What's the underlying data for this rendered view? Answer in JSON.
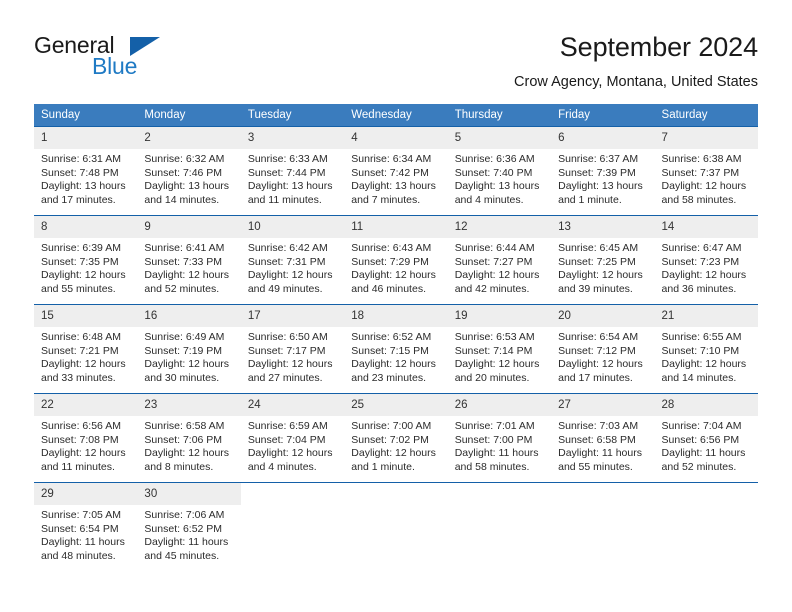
{
  "brand": {
    "name_part1": "General",
    "name_part2": "Blue",
    "logo_icon": "triangle-logo-icon"
  },
  "header": {
    "title": "September 2024",
    "subtitle": "Crow Agency, Montana, United States"
  },
  "colors": {
    "header_blue": "#3a7cbe",
    "row_border_blue": "#1460a8",
    "daynum_band": "#eeeeee",
    "brand_blue": "#1f7ac4",
    "text": "#2b2b2b"
  },
  "weekday_headers": [
    "Sunday",
    "Monday",
    "Tuesday",
    "Wednesday",
    "Thursday",
    "Friday",
    "Saturday"
  ],
  "labels": {
    "sunrise": "Sunrise:",
    "sunset": "Sunset:",
    "daylight": "Daylight:"
  },
  "weeks": [
    [
      {
        "day": "1",
        "sunrise": "Sunrise: 6:31 AM",
        "sunset": "Sunset: 7:48 PM",
        "daylight": "Daylight: 13 hours and 17 minutes."
      },
      {
        "day": "2",
        "sunrise": "Sunrise: 6:32 AM",
        "sunset": "Sunset: 7:46 PM",
        "daylight": "Daylight: 13 hours and 14 minutes."
      },
      {
        "day": "3",
        "sunrise": "Sunrise: 6:33 AM",
        "sunset": "Sunset: 7:44 PM",
        "daylight": "Daylight: 13 hours and 11 minutes."
      },
      {
        "day": "4",
        "sunrise": "Sunrise: 6:34 AM",
        "sunset": "Sunset: 7:42 PM",
        "daylight": "Daylight: 13 hours and 7 minutes."
      },
      {
        "day": "5",
        "sunrise": "Sunrise: 6:36 AM",
        "sunset": "Sunset: 7:40 PM",
        "daylight": "Daylight: 13 hours and 4 minutes."
      },
      {
        "day": "6",
        "sunrise": "Sunrise: 6:37 AM",
        "sunset": "Sunset: 7:39 PM",
        "daylight": "Daylight: 13 hours and 1 minute."
      },
      {
        "day": "7",
        "sunrise": "Sunrise: 6:38 AM",
        "sunset": "Sunset: 7:37 PM",
        "daylight": "Daylight: 12 hours and 58 minutes."
      }
    ],
    [
      {
        "day": "8",
        "sunrise": "Sunrise: 6:39 AM",
        "sunset": "Sunset: 7:35 PM",
        "daylight": "Daylight: 12 hours and 55 minutes."
      },
      {
        "day": "9",
        "sunrise": "Sunrise: 6:41 AM",
        "sunset": "Sunset: 7:33 PM",
        "daylight": "Daylight: 12 hours and 52 minutes."
      },
      {
        "day": "10",
        "sunrise": "Sunrise: 6:42 AM",
        "sunset": "Sunset: 7:31 PM",
        "daylight": "Daylight: 12 hours and 49 minutes."
      },
      {
        "day": "11",
        "sunrise": "Sunrise: 6:43 AM",
        "sunset": "Sunset: 7:29 PM",
        "daylight": "Daylight: 12 hours and 46 minutes."
      },
      {
        "day": "12",
        "sunrise": "Sunrise: 6:44 AM",
        "sunset": "Sunset: 7:27 PM",
        "daylight": "Daylight: 12 hours and 42 minutes."
      },
      {
        "day": "13",
        "sunrise": "Sunrise: 6:45 AM",
        "sunset": "Sunset: 7:25 PM",
        "daylight": "Daylight: 12 hours and 39 minutes."
      },
      {
        "day": "14",
        "sunrise": "Sunrise: 6:47 AM",
        "sunset": "Sunset: 7:23 PM",
        "daylight": "Daylight: 12 hours and 36 minutes."
      }
    ],
    [
      {
        "day": "15",
        "sunrise": "Sunrise: 6:48 AM",
        "sunset": "Sunset: 7:21 PM",
        "daylight": "Daylight: 12 hours and 33 minutes."
      },
      {
        "day": "16",
        "sunrise": "Sunrise: 6:49 AM",
        "sunset": "Sunset: 7:19 PM",
        "daylight": "Daylight: 12 hours and 30 minutes."
      },
      {
        "day": "17",
        "sunrise": "Sunrise: 6:50 AM",
        "sunset": "Sunset: 7:17 PM",
        "daylight": "Daylight: 12 hours and 27 minutes."
      },
      {
        "day": "18",
        "sunrise": "Sunrise: 6:52 AM",
        "sunset": "Sunset: 7:15 PM",
        "daylight": "Daylight: 12 hours and 23 minutes."
      },
      {
        "day": "19",
        "sunrise": "Sunrise: 6:53 AM",
        "sunset": "Sunset: 7:14 PM",
        "daylight": "Daylight: 12 hours and 20 minutes."
      },
      {
        "day": "20",
        "sunrise": "Sunrise: 6:54 AM",
        "sunset": "Sunset: 7:12 PM",
        "daylight": "Daylight: 12 hours and 17 minutes."
      },
      {
        "day": "21",
        "sunrise": "Sunrise: 6:55 AM",
        "sunset": "Sunset: 7:10 PM",
        "daylight": "Daylight: 12 hours and 14 minutes."
      }
    ],
    [
      {
        "day": "22",
        "sunrise": "Sunrise: 6:56 AM",
        "sunset": "Sunset: 7:08 PM",
        "daylight": "Daylight: 12 hours and 11 minutes."
      },
      {
        "day": "23",
        "sunrise": "Sunrise: 6:58 AM",
        "sunset": "Sunset: 7:06 PM",
        "daylight": "Daylight: 12 hours and 8 minutes."
      },
      {
        "day": "24",
        "sunrise": "Sunrise: 6:59 AM",
        "sunset": "Sunset: 7:04 PM",
        "daylight": "Daylight: 12 hours and 4 minutes."
      },
      {
        "day": "25",
        "sunrise": "Sunrise: 7:00 AM",
        "sunset": "Sunset: 7:02 PM",
        "daylight": "Daylight: 12 hours and 1 minute."
      },
      {
        "day": "26",
        "sunrise": "Sunrise: 7:01 AM",
        "sunset": "Sunset: 7:00 PM",
        "daylight": "Daylight: 11 hours and 58 minutes."
      },
      {
        "day": "27",
        "sunrise": "Sunrise: 7:03 AM",
        "sunset": "Sunset: 6:58 PM",
        "daylight": "Daylight: 11 hours and 55 minutes."
      },
      {
        "day": "28",
        "sunrise": "Sunrise: 7:04 AM",
        "sunset": "Sunset: 6:56 PM",
        "daylight": "Daylight: 11 hours and 52 minutes."
      }
    ],
    [
      {
        "day": "29",
        "sunrise": "Sunrise: 7:05 AM",
        "sunset": "Sunset: 6:54 PM",
        "daylight": "Daylight: 11 hours and 48 minutes."
      },
      {
        "day": "30",
        "sunrise": "Sunrise: 7:06 AM",
        "sunset": "Sunset: 6:52 PM",
        "daylight": "Daylight: 11 hours and 45 minutes."
      },
      {
        "day": "",
        "sunrise": "",
        "sunset": "",
        "daylight": ""
      },
      {
        "day": "",
        "sunrise": "",
        "sunset": "",
        "daylight": ""
      },
      {
        "day": "",
        "sunrise": "",
        "sunset": "",
        "daylight": ""
      },
      {
        "day": "",
        "sunrise": "",
        "sunset": "",
        "daylight": ""
      },
      {
        "day": "",
        "sunrise": "",
        "sunset": "",
        "daylight": ""
      }
    ]
  ]
}
